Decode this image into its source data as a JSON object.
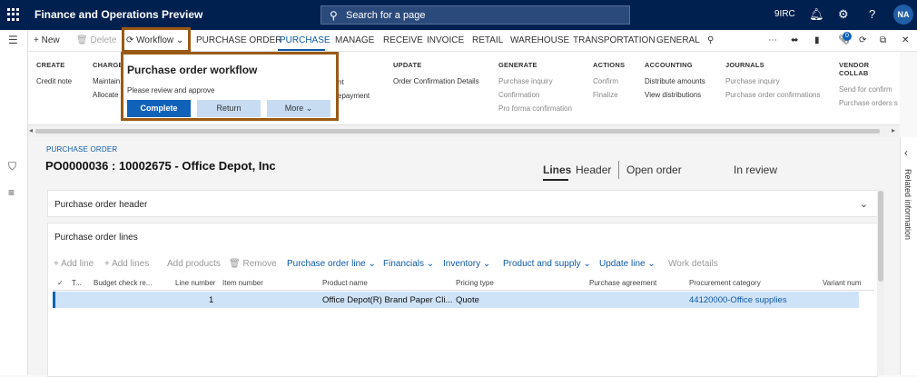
{
  "header": {
    "app_title": "Finance and Operations Preview",
    "search_placeholder": "Search for a page",
    "company": "9IRC",
    "user_initials": "NA"
  },
  "action_pane": {
    "new": "New",
    "delete": "Delete",
    "workflow": "Workflow",
    "tabs": [
      "PURCHASE ORDER",
      "PURCHASE",
      "MANAGE",
      "RECEIVE",
      "INVOICE",
      "RETAIL",
      "WAREHOUSE",
      "TRANSPORTATION",
      "GENERAL"
    ],
    "active_tab": "PURCHASE",
    "notification_count": "0"
  },
  "ribbon": {
    "create": {
      "title": "CREATE",
      "items": [
        "Credit note"
      ]
    },
    "charges": {
      "title": "CHARGES",
      "items": [
        "Maintain",
        "Allocate"
      ]
    },
    "partial": {
      "items": [
        "nt",
        "epayment"
      ]
    },
    "update": {
      "title": "UPDATE",
      "items": [
        "Order Confirmation Details"
      ]
    },
    "generate": {
      "title": "GENERATE",
      "items": [
        "Purchase inquiry",
        "Confirmation",
        "Pro forma confirmation"
      ]
    },
    "actions": {
      "title": "ACTIONS",
      "items": [
        "Confirm",
        "Finalize"
      ]
    },
    "accounting": {
      "title": "ACCOUNTING",
      "items": [
        "Distribute amounts",
        "View distributions"
      ]
    },
    "journals": {
      "title": "JOURNALS",
      "items": [
        "Purchase inquiry",
        "Purchase order confirmations"
      ]
    },
    "vendor_collab": {
      "title": "VENDOR COLLAB",
      "items": [
        "Send for confirm",
        "Purchase orders s"
      ]
    }
  },
  "workflow_flyout": {
    "title": "Purchase order workflow",
    "subtitle": "Please review and approve",
    "complete": "Complete",
    "return": "Return",
    "more": "More"
  },
  "record": {
    "breadcrumb": "PURCHASE ORDER",
    "title": "PO0000036 : 10002675 - Office Depot, Inc",
    "view_tabs": [
      "Lines",
      "Header"
    ],
    "active_view": "Lines",
    "status_label": "Open order",
    "approval_status": "In review"
  },
  "sections": {
    "header": "Purchase order header",
    "lines": "Purchase order lines"
  },
  "lines_toolbar": {
    "add_line": "Add line",
    "add_lines": "Add lines",
    "add_products": "Add products",
    "remove": "Remove",
    "menus": [
      "Purchase order line",
      "Financials",
      "Inventory",
      "Product and supply",
      "Update line"
    ],
    "work_details": "Work details"
  },
  "grid": {
    "columns": [
      "T...",
      "Budget check re...",
      "Line number",
      "Item number",
      "Product name",
      "Pricing type",
      "Purchase agreement",
      "Procurement category",
      "Variant num"
    ],
    "rows": [
      {
        "line_number": "1",
        "item_number": "",
        "product_name": "Office Depot(R) Brand Paper Cli...",
        "pricing_type": "Quote",
        "purchase_agreement": "",
        "procurement_category": "44120000-Office supplies",
        "variant": ""
      }
    ]
  },
  "related_info": "Related information"
}
